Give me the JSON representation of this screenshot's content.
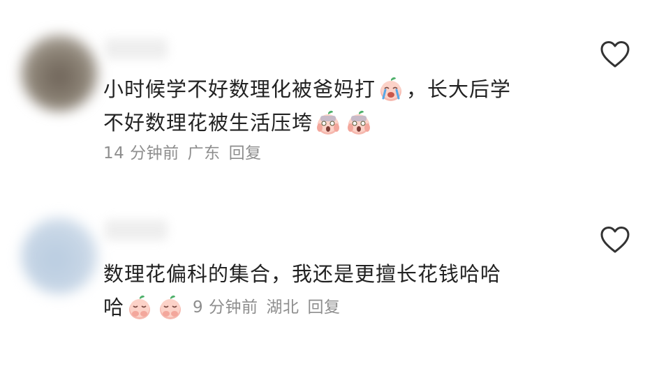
{
  "comments": [
    {
      "line1_a": "小时候学不好数理化被爸妈打",
      "emoji1": "crying-peach-emoji",
      "line1_b": "，长大后学",
      "line2": "不好数理花被生活压垮",
      "line2_emojis": [
        "scared-peach-emoji",
        "scared-peach-emoji"
      ],
      "time": "14 分钟前",
      "location": "广东",
      "reply_label": "回复",
      "like_icon": "heart-outline-icon"
    },
    {
      "line1": "数理花偏科的集合，我还是更擅长花钱哈哈",
      "line2": "哈",
      "line2_emojis": [
        "covering-mouth-peach-emoji",
        "covering-mouth-peach-emoji"
      ],
      "time": "9 分钟前",
      "location": "湖北",
      "reply_label": "回复",
      "like_icon": "heart-outline-icon"
    }
  ],
  "colors": {
    "text": "#222222",
    "meta": "#8e8e8e",
    "background": "#ffffff",
    "icon": "#333333"
  }
}
